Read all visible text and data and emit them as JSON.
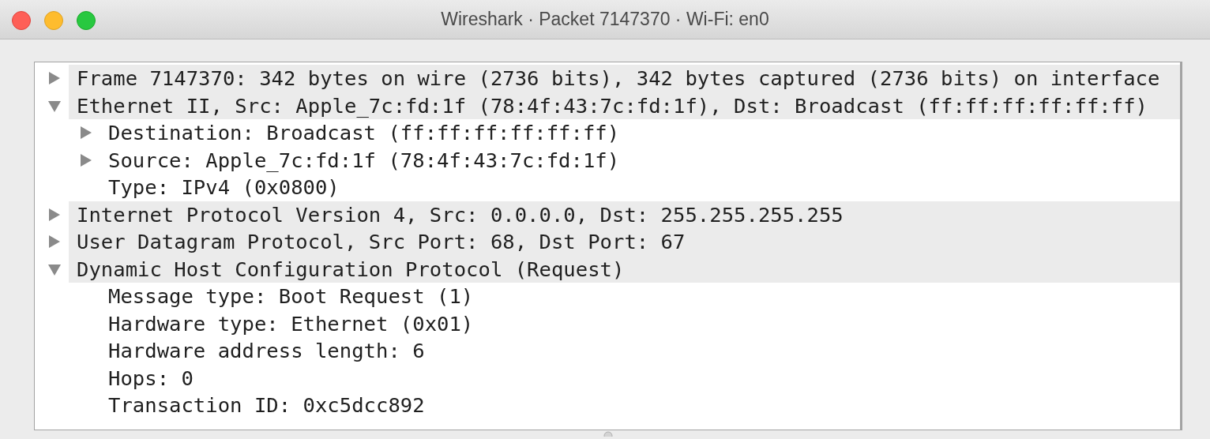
{
  "window": {
    "title": "Wireshark · Packet 7147370 · Wi-Fi: en0"
  },
  "tree": [
    {
      "label": "Frame 7147370: 342 bytes on wire (2736 bits), 342 bytes captured (2736 bits) on interface",
      "expanded": false
    },
    {
      "label": "Ethernet II, Src: Apple_7c:fd:1f (78:4f:43:7c:fd:1f), Dst: Broadcast (ff:ff:ff:ff:ff:ff)",
      "expanded": true,
      "children": [
        {
          "label": "Destination: Broadcast (ff:ff:ff:ff:ff:ff)",
          "expanded": false
        },
        {
          "label": "Source: Apple_7c:fd:1f (78:4f:43:7c:fd:1f)",
          "expanded": false
        },
        {
          "label": "Type: IPv4 (0x0800)"
        }
      ]
    },
    {
      "label": "Internet Protocol Version 4, Src: 0.0.0.0, Dst: 255.255.255.255",
      "expanded": false
    },
    {
      "label": "User Datagram Protocol, Src Port: 68, Dst Port: 67",
      "expanded": false
    },
    {
      "label": "Dynamic Host Configuration Protocol (Request)",
      "expanded": true,
      "children": [
        {
          "label": "Message type: Boot Request (1)"
        },
        {
          "label": "Hardware type: Ethernet (0x01)"
        },
        {
          "label": "Hardware address length: 6"
        },
        {
          "label": "Hops: 0"
        },
        {
          "label": "Transaction ID: 0xc5dcc892"
        }
      ]
    }
  ]
}
